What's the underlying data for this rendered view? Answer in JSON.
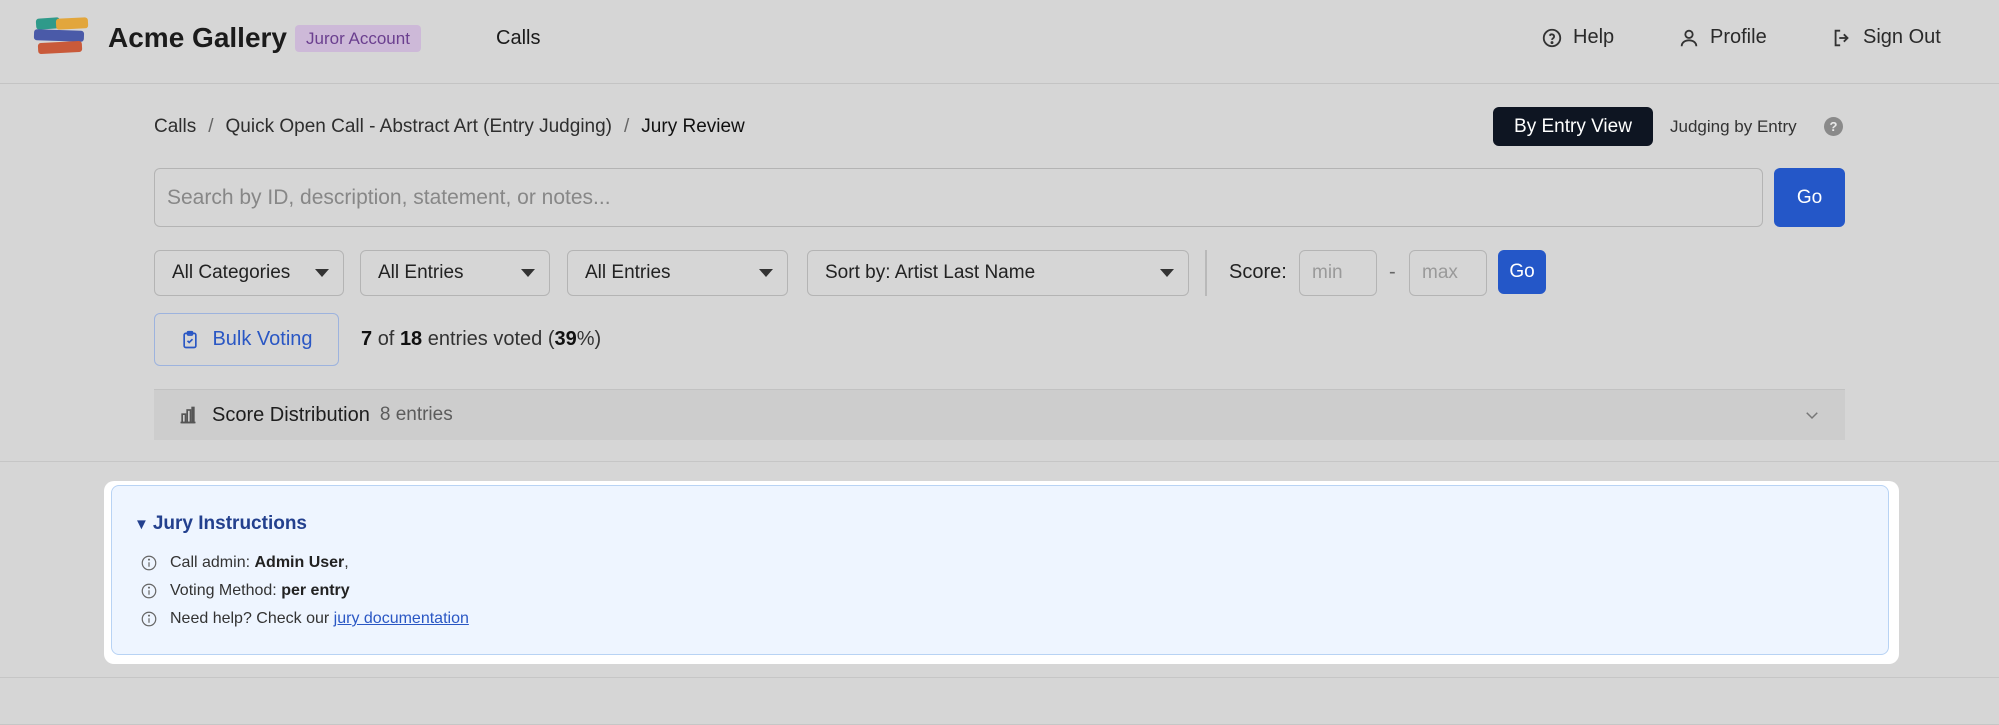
{
  "app": {
    "brand": "Acme Gallery",
    "role_badge": "Juror Account",
    "nav_calls": "Calls",
    "links": {
      "help": "Help",
      "profile": "Profile",
      "sign_out": "Sign Out"
    },
    "logo_colors": [
      "#2f9a8a",
      "#e2a63c",
      "#4a5aa8",
      "#c95a3a"
    ]
  },
  "breadcrumb": {
    "items": [
      "Calls",
      "Quick Open Call - Abstract Art (Entry Judging)",
      "Jury Review"
    ],
    "separator": "/"
  },
  "view": {
    "button_label": "By Entry View",
    "judging_label": "Judging by Entry",
    "help_glyph": "?"
  },
  "search": {
    "placeholder": "Search by ID, description, statement, or notes...",
    "value": "",
    "go_label": "Go"
  },
  "filters": {
    "category": "All Categories",
    "entries_1": "All Entries",
    "entries_2": "All Entries",
    "sort": "Sort by: Artist Last Name",
    "score_label": "Score:",
    "min_placeholder": "min",
    "max_placeholder": "max",
    "range_dash": "-",
    "go_label": "Go"
  },
  "progress": {
    "bulk_label": "Bulk Voting",
    "voted": "7",
    "of_word": "of",
    "total": "18",
    "entries_voted_word": "entries voted (",
    "percent": "39",
    "percent_suffix": "%)"
  },
  "distribution": {
    "title": "Score Distribution",
    "count": "8 entries"
  },
  "instructions": {
    "title": "Jury Instructions",
    "admin_prefix": "Call admin:",
    "admin_name": "Admin User",
    "admin_suffix": ",",
    "method_prefix": "Voting Method:",
    "method_value": "per entry",
    "help_prefix": "Need help? Check our",
    "help_link": "jury documentation"
  },
  "colors": {
    "primary": "#2457c8",
    "dark_button": "#0e1522",
    "badge_bg": "#cdb9d8",
    "instructions_bg": "#eef5ff"
  }
}
